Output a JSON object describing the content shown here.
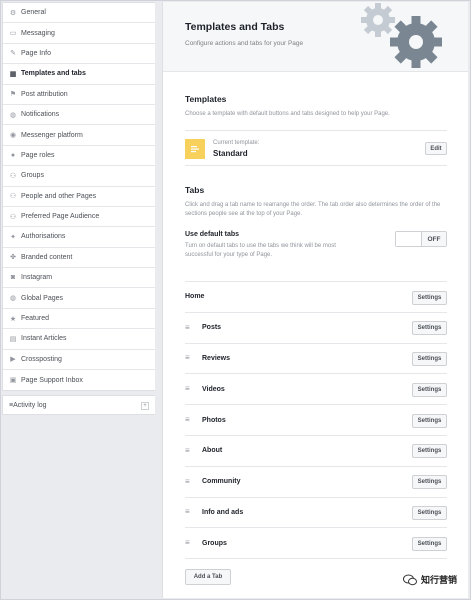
{
  "sidebar": {
    "items": [
      {
        "label": "General",
        "icon": "gear-icon"
      },
      {
        "label": "Messaging",
        "icon": "chat-icon"
      },
      {
        "label": "Page Info",
        "icon": "pencil-icon"
      },
      {
        "label": "Templates and tabs",
        "icon": "grid-icon",
        "active": true
      },
      {
        "label": "Post attribution",
        "icon": "flag-icon"
      },
      {
        "label": "Notifications",
        "icon": "globe-icon"
      },
      {
        "label": "Messenger platform",
        "icon": "messenger-icon"
      },
      {
        "label": "Page roles",
        "icon": "person-icon"
      },
      {
        "label": "Groups",
        "icon": "group-icon"
      },
      {
        "label": "People and other Pages",
        "icon": "people-icon"
      },
      {
        "label": "Preferred Page Audience",
        "icon": "people-icon"
      },
      {
        "label": "Authorisations",
        "icon": "wrench-icon"
      },
      {
        "label": "Branded content",
        "icon": "handshake-icon"
      },
      {
        "label": "Instagram",
        "icon": "instagram-icon"
      },
      {
        "label": "Global Pages",
        "icon": "globe-icon"
      },
      {
        "label": "Featured",
        "icon": "star-icon"
      },
      {
        "label": "Instant Articles",
        "icon": "article-icon"
      },
      {
        "label": "Crossposting",
        "icon": "video-icon"
      },
      {
        "label": "Page Support Inbox",
        "icon": "inbox-icon"
      }
    ],
    "activity_log": {
      "label": "Activity log",
      "icon": "list-icon"
    }
  },
  "header": {
    "title": "Templates and Tabs",
    "subtitle": "Configure actions and tabs for your Page"
  },
  "templates": {
    "title": "Templates",
    "description": "Choose a template with default buttons and tabs designed to help your Page.",
    "current_label": "Current template:",
    "current_name": "Standard",
    "edit_label": "Edit"
  },
  "tabs_section": {
    "title": "Tabs",
    "description": "Click and drag a tab name to rearrange the order. The tab order also determines the order of the sections people see at the top of your Page.",
    "default_tabs_label": "Use default tabs",
    "default_tabs_description": "Turn on default tabs to use the tabs we think will be most successful for your type of Page.",
    "toggle_state": "OFF"
  },
  "tab_rows": [
    {
      "name": "Home",
      "draggable": false
    },
    {
      "name": "Posts",
      "draggable": true
    },
    {
      "name": "Reviews",
      "draggable": true
    },
    {
      "name": "Videos",
      "draggable": true
    },
    {
      "name": "Photos",
      "draggable": true
    },
    {
      "name": "About",
      "draggable": true
    },
    {
      "name": "Community",
      "draggable": true
    },
    {
      "name": "Info and ads",
      "draggable": true
    },
    {
      "name": "Groups",
      "draggable": true
    }
  ],
  "settings_label": "Settings",
  "add_tab_label": "Add a Tab",
  "watermark": {
    "text": "知行营销"
  },
  "colors": {
    "accent": "#f7d15b",
    "gear_dark": "#7a8793",
    "gear_light": "#c4cbd2"
  }
}
